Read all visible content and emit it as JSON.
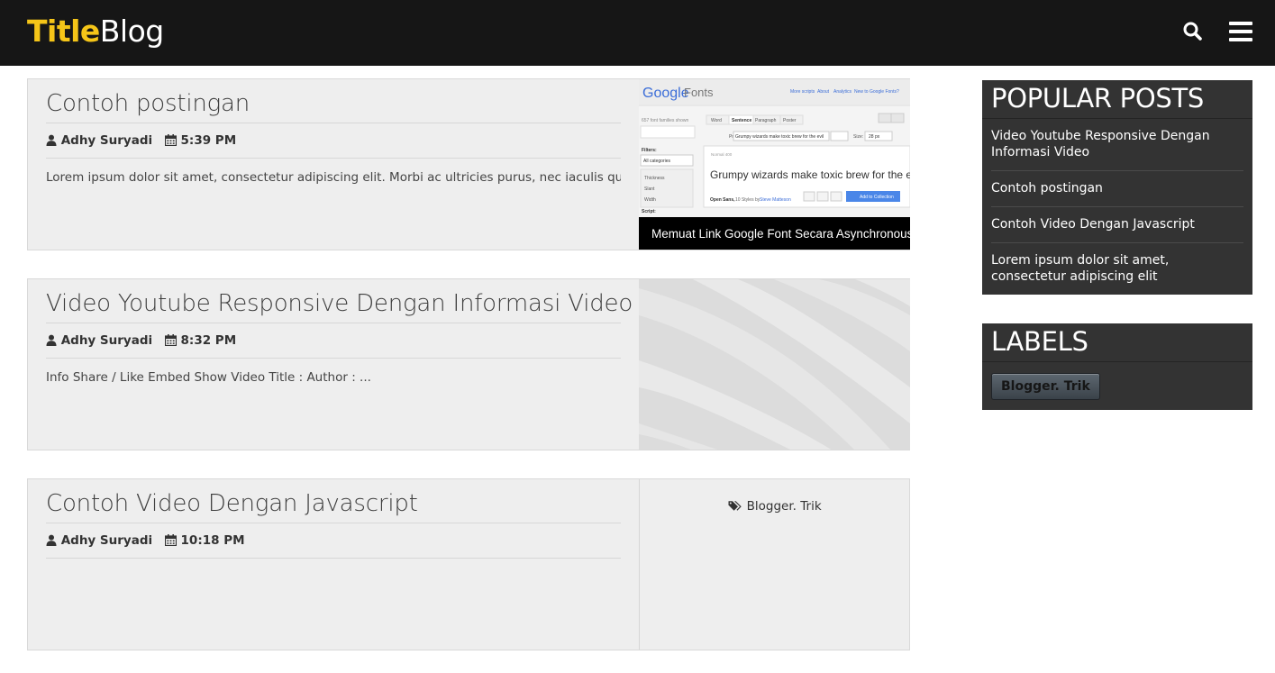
{
  "site": {
    "title_part1": "Title",
    "title_part2": "Blog"
  },
  "header": {
    "icons": [
      "search-icon",
      "menu-icon"
    ]
  },
  "posts": [
    {
      "title": "Contoh postingan",
      "author": "Adhy Suryadi",
      "time": "5:39 PM",
      "excerpt": "Lorem ipsum dolor sit amet, consectetur adipiscing elit. Morbi ac ultricies purus, nec iaculis qu...",
      "thumbnail": {
        "brand_g": "Google",
        "brand_f": "Fonts",
        "nav_links": [
          "More scripts",
          "About",
          "Analytics",
          "New to Google Fonts?"
        ],
        "families_shown": "657 font families shown",
        "tabs": [
          "Word",
          "Sentence",
          "Paragraph",
          "Poster"
        ],
        "preview_label": "Preview Text:",
        "preview_value": "Grumpy wizards make toxic brew for the evil",
        "size_label": "Size:",
        "size_value": "28 px",
        "filters_label": "Filters:",
        "filter_select": "All categories",
        "filter_options": [
          "Thickness",
          "Slant",
          "Width"
        ],
        "script_label": "Script:",
        "sample_text": "Grumpy wizards make toxic brew for the evil Q",
        "sample_small": "Normal 400",
        "font_name": "Open Sans,",
        "font_styles": "10 Styles by",
        "font_designer": "Steve Matteson",
        "add_button": "Add to Collection",
        "caption": "Memuat Link Google Font Secara Asynchronous"
      }
    },
    {
      "title": "Video Youtube Responsive Dengan Informasi Video",
      "author": "Adhy Suryadi",
      "time": "8:32 PM",
      "excerpt": "Info Share / Like Embed Show Video Title : Author : ..."
    },
    {
      "title": "Contoh Video Dengan Javascript",
      "author": "Adhy Suryadi",
      "time": "10:18 PM",
      "excerpt": "",
      "label": "Blogger. Trik"
    }
  ],
  "popular_posts": {
    "title": "POPULAR POSTS",
    "items": [
      "Video Youtube Responsive Dengan Informasi Video",
      "Contoh postingan",
      "Contoh Video Dengan Javascript",
      "Lorem ipsum dolor sit amet, consectetur adipiscing elit"
    ]
  },
  "labels": {
    "title": "LABELS",
    "items": [
      "Blogger. Trik"
    ]
  },
  "colors": {
    "header_bg": "#161616",
    "brand_accent": "#f5c518",
    "post_bg": "#eeeeee",
    "widget_bg": "#333333"
  }
}
